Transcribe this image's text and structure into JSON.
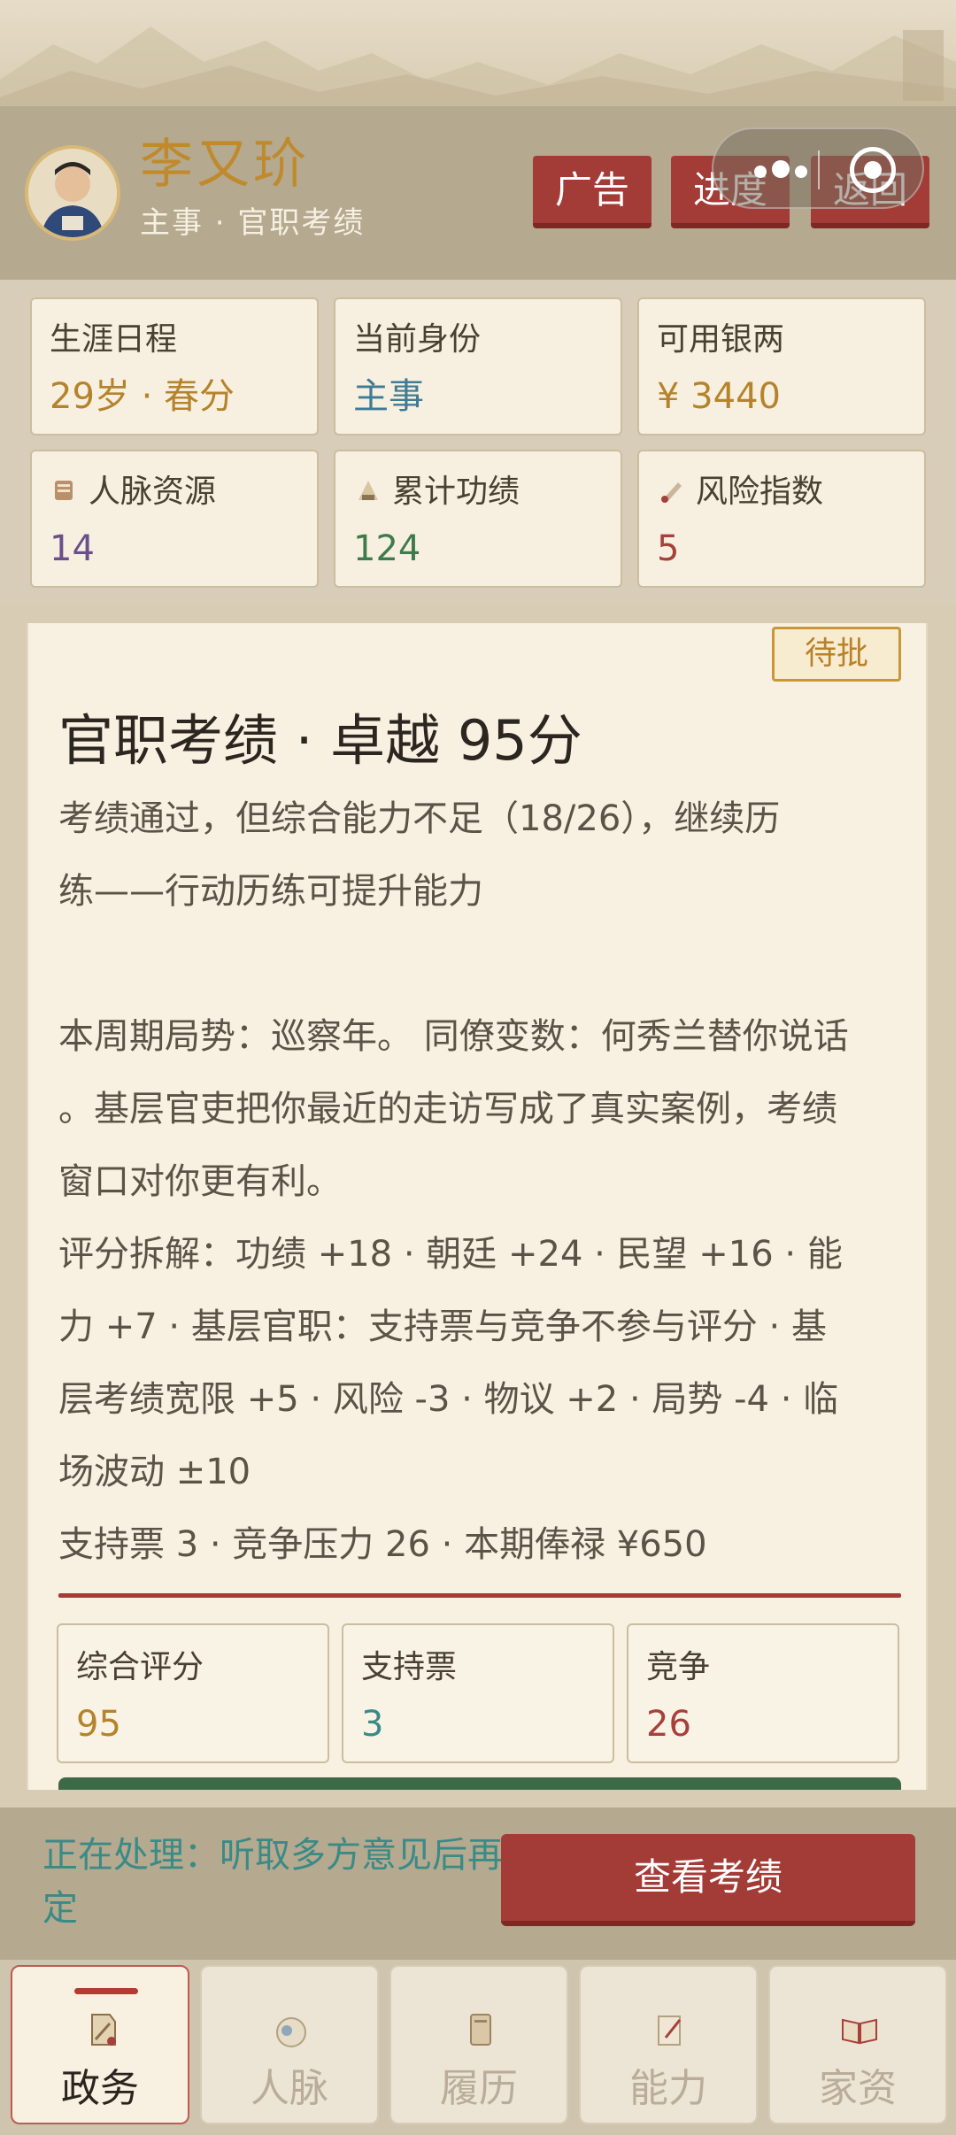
{
  "header": {
    "name": "李又玠",
    "subtitle": "主事 · 官职考绩",
    "buttons": [
      "广告",
      "进度",
      "返回"
    ]
  },
  "stats": [
    {
      "label": "生涯日程",
      "value": "29岁 · 春分",
      "color": "#b5832c",
      "icon": ""
    },
    {
      "label": "当前身份",
      "value": "主事",
      "color": "#3f7b95",
      "icon": ""
    },
    {
      "label": "可用银两",
      "value": "¥ 3440",
      "color": "#b5832c",
      "icon": ""
    },
    {
      "label": "人脉资源",
      "value": "14",
      "color": "#6a4f8a",
      "icon": "scroll-icon"
    },
    {
      "label": "累计功绩",
      "value": "124",
      "color": "#3f7a4c",
      "icon": "merit-icon"
    },
    {
      "label": "风险指数",
      "value": "5",
      "color": "#a7403a",
      "icon": "brush-icon"
    }
  ],
  "card": {
    "badge": "待批",
    "title": "官职考绩 · 卓越 95分",
    "lines": [
      "考绩通过，但综合能力不足（18/26），继续历",
      "练——行动历练可提升能力",
      "",
      "本周期局势：巡察年。 同僚变数：何秀兰替你说话",
      "。基层官吏把你最近的走访写成了真实案例，考绩",
      "窗口对你更有利。",
      "评分拆解：功绩 +18 · 朝廷 +24 · 民望 +16 · 能",
      "力 +7 · 基层官职：支持票与竞争不参与评分 · 基",
      "层考绩宽限 +5 · 风险 -3 · 物议 +2 · 局势 -4 · 临",
      "场波动 ±10",
      "支持票 3 · 竞争压力 26 · 本期俸禄 ¥650"
    ],
    "metrics": [
      {
        "label": "综合评分",
        "value": "95",
        "color": "#b5832c"
      },
      {
        "label": "支持票",
        "value": "3",
        "color": "#3a8a86"
      },
      {
        "label": "竞争",
        "value": "26",
        "color": "#a7403a"
      }
    ]
  },
  "action": {
    "status": "正在处理：听取多方意见后再定",
    "button": "查看考绩"
  },
  "tabs": [
    {
      "label": "政务",
      "icon": "document-icon",
      "active": true
    },
    {
      "label": "人脉",
      "icon": "pouch-icon",
      "active": false
    },
    {
      "label": "履历",
      "icon": "book-icon",
      "active": false
    },
    {
      "label": "能力",
      "icon": "brush-icon",
      "active": false
    },
    {
      "label": "家资",
      "icon": "open-book-icon",
      "active": false
    }
  ]
}
